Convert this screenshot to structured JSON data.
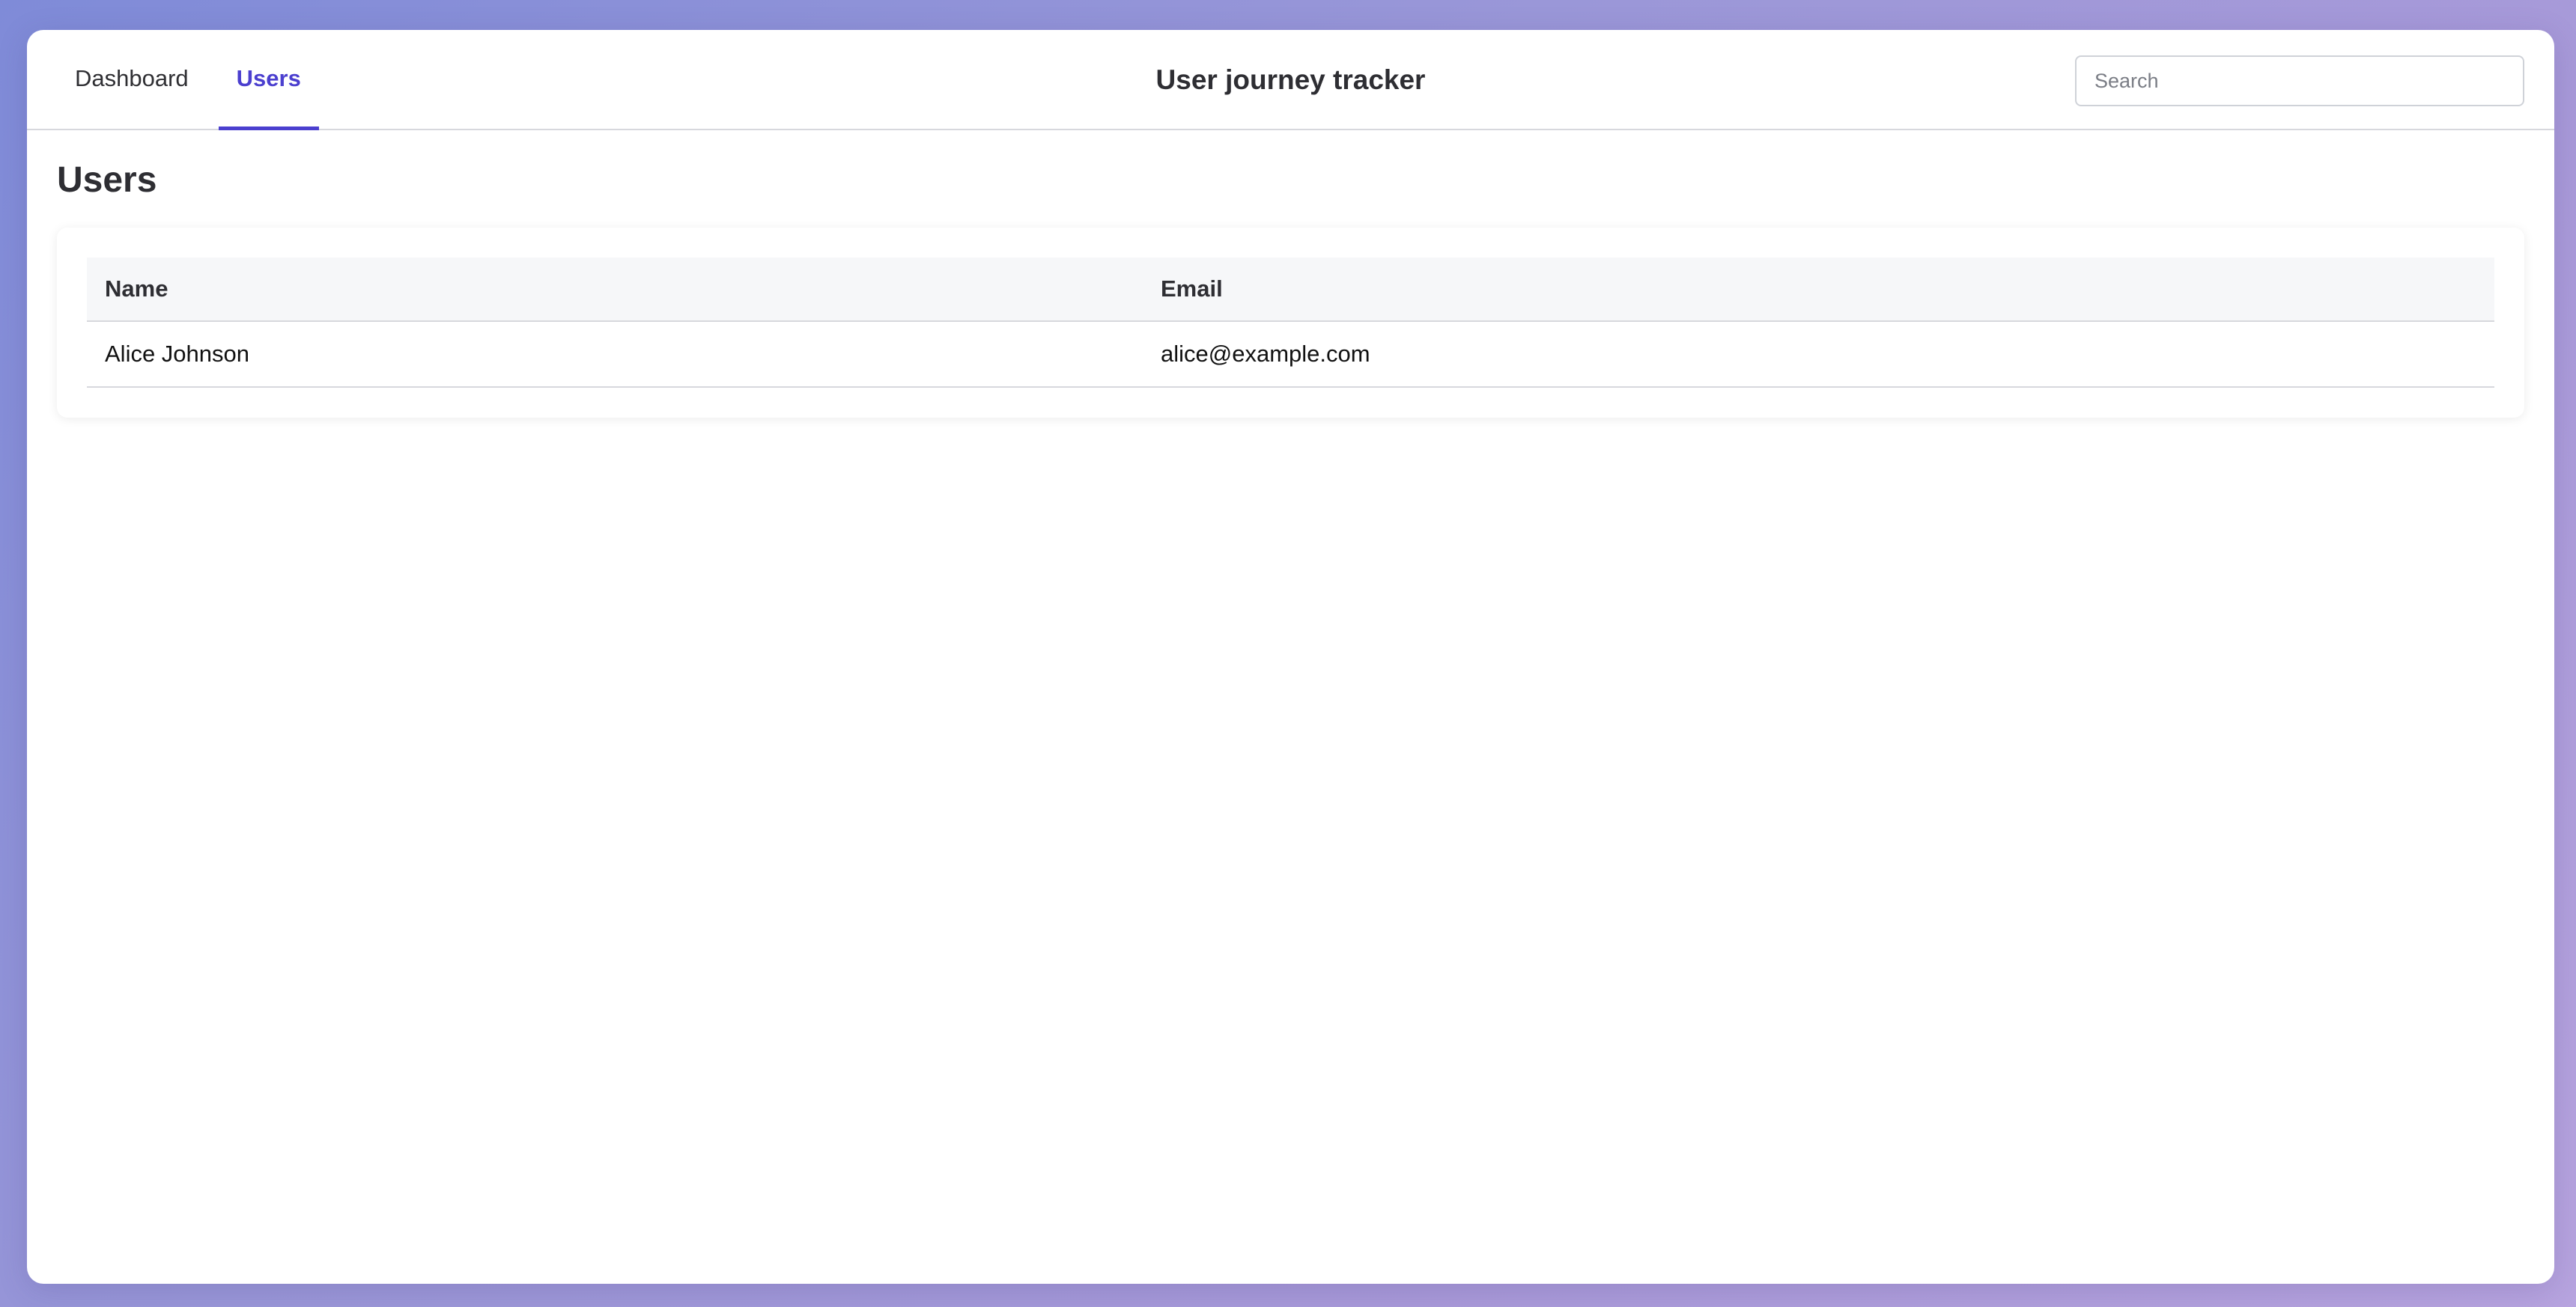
{
  "nav": {
    "tabs": [
      {
        "label": "Dashboard",
        "active": false
      },
      {
        "label": "Users",
        "active": true
      }
    ]
  },
  "header": {
    "title": "User journey tracker"
  },
  "search": {
    "placeholder": "Search",
    "value": ""
  },
  "main": {
    "title": "Users",
    "table": {
      "columns": [
        "Name",
        "Email"
      ],
      "rows": [
        [
          "Alice Johnson",
          "alice@example.com"
        ]
      ]
    }
  },
  "colors": {
    "accent": "#4b3fcf",
    "background_gradient_start": "#7f8bd8",
    "background_gradient_end": "#b7a4df"
  }
}
